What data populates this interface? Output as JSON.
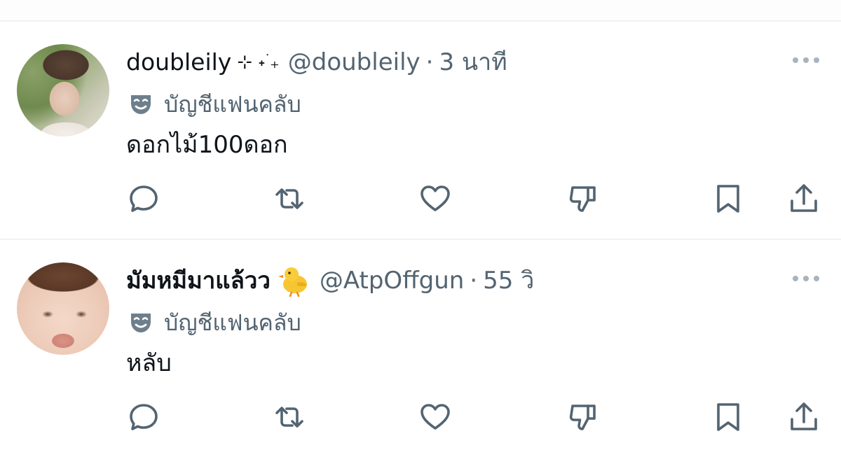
{
  "replies": [
    {
      "display_name": "doubleily",
      "name_decoration": "⊹ ˖ ࣪₊",
      "handle": "@doubleily",
      "separator": "·",
      "timestamp": "3 นาที",
      "badge_label": "บัญชีแฟนคลับ",
      "text": "ดอกไม้100ดอก",
      "name_bold": false
    },
    {
      "display_name": "มัมหมีมาแล้วว",
      "name_emoji": "baby-chick",
      "handle": "@AtpOffgun",
      "separator": "·",
      "timestamp": "55 วิ",
      "badge_label": "บัญชีแฟนคลับ",
      "text": "หลับ",
      "name_bold": true
    }
  ],
  "icons": {
    "more": "more-dots-icon",
    "badge": "theater-mask-icon",
    "reply": "reply-bubble-icon",
    "repost": "repost-icon",
    "like": "heart-icon",
    "dislike": "thumb-down-icon",
    "bookmark": "bookmark-icon",
    "share": "share-icon"
  },
  "colors": {
    "text_primary": "#0f1419",
    "text_secondary": "#536471",
    "icon_gray": "#536471",
    "divider": "#eff3f4",
    "more_dots": "#a8b3bd"
  }
}
